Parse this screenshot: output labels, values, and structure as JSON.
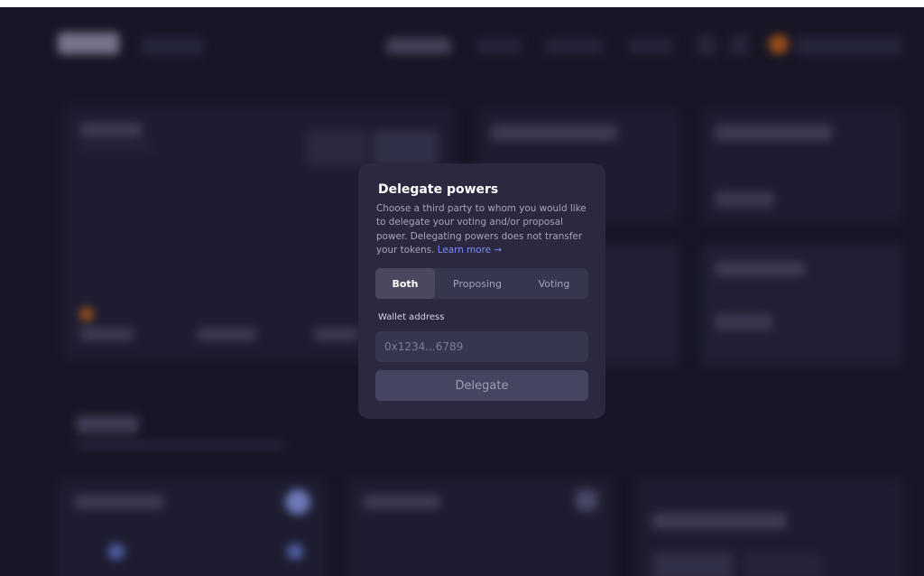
{
  "modal": {
    "title": "Delegate powers",
    "description": "Choose a third party to whom you would like to delegate your voting and/or proposal power. Delegating powers does not transfer your tokens.",
    "learn_more": "Learn more →",
    "tabs": [
      {
        "label": "Both",
        "active": true
      },
      {
        "label": "Proposing",
        "active": false
      },
      {
        "label": "Voting",
        "active": false
      }
    ],
    "wallet_label": "Wallet address",
    "wallet_placeholder": "0x1234...6789",
    "wallet_value": "",
    "delegate_label": "Delegate"
  },
  "colors": {
    "background": "#1b1a2c",
    "modal_bg": "#2a2940",
    "link": "#7f8cf7",
    "segment_active": "#49485f"
  }
}
